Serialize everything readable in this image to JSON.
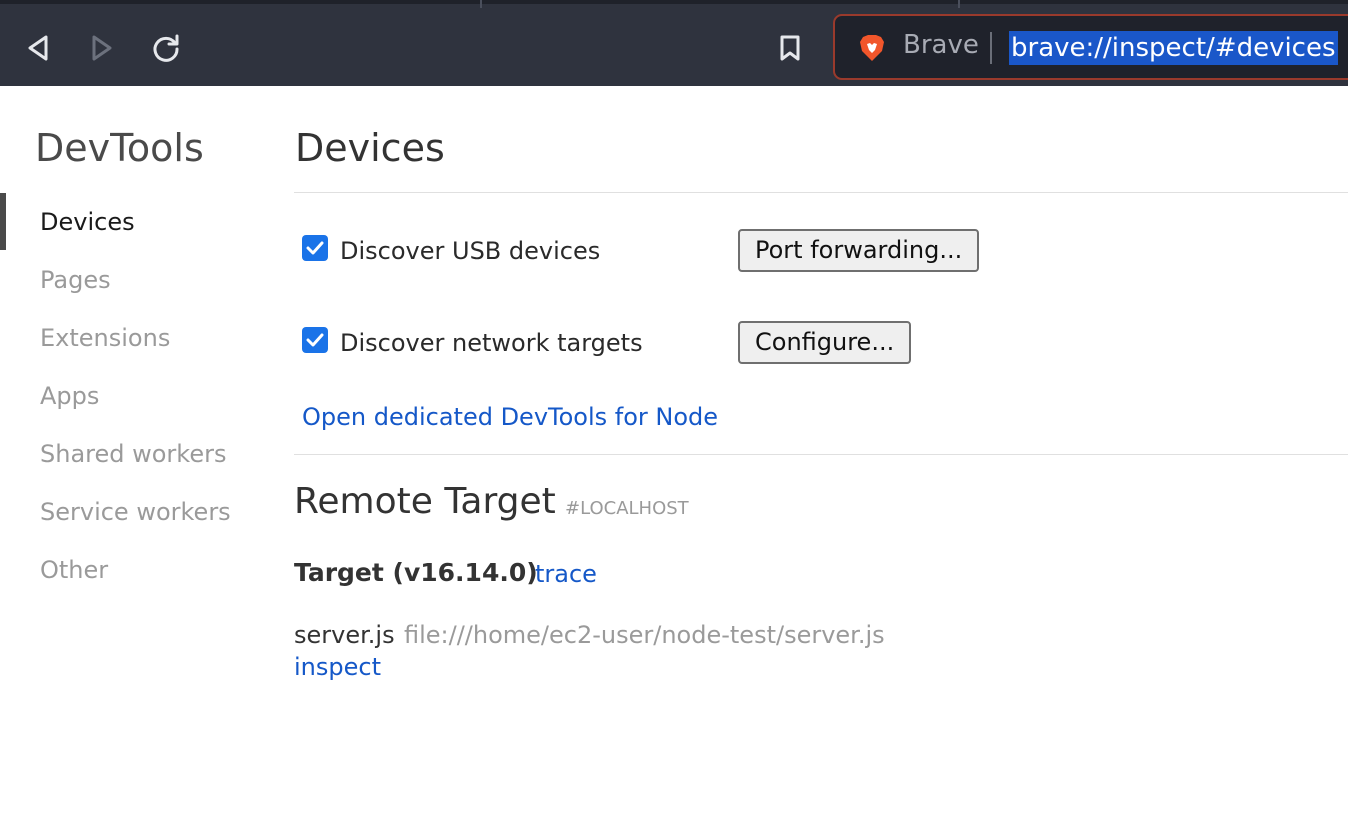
{
  "browser": {
    "back_icon": "back-arrow-icon",
    "forward_icon": "forward-arrow-icon",
    "reload_icon": "reload-icon",
    "bookmark_icon": "bookmark-icon",
    "brand_logo": "brave-lion-icon",
    "brand_name": "Brave",
    "url": "brave://inspect/#devices",
    "colors": {
      "toolbar_bg": "#2f333e",
      "url_highlight": "#1a57c9",
      "focus_ring": "#9a3a2c"
    }
  },
  "sidebar": {
    "title": "DevTools",
    "items": [
      {
        "label": "Devices",
        "active": true
      },
      {
        "label": "Pages",
        "active": false
      },
      {
        "label": "Extensions",
        "active": false
      },
      {
        "label": "Apps",
        "active": false
      },
      {
        "label": "Shared workers",
        "active": false
      },
      {
        "label": "Service workers",
        "active": false
      },
      {
        "label": "Other",
        "active": false
      }
    ]
  },
  "main": {
    "title": "Devices",
    "options": [
      {
        "label": "Discover USB devices",
        "checked": true,
        "button": "Port forwarding..."
      },
      {
        "label": "Discover network targets",
        "checked": true,
        "button": "Configure..."
      }
    ],
    "node_link": "Open dedicated DevTools for Node",
    "remote": {
      "title": "Remote Target",
      "tag": "#LOCALHOST",
      "target_name": "Target (v16.14.0)",
      "trace_link": "trace",
      "entry_name": "server.js",
      "entry_url": "file:///home/ec2-user/node-test/server.js",
      "inspect_link": "inspect"
    },
    "colors": {
      "link": "#1558c8",
      "checkbox": "#1a73e8"
    }
  }
}
